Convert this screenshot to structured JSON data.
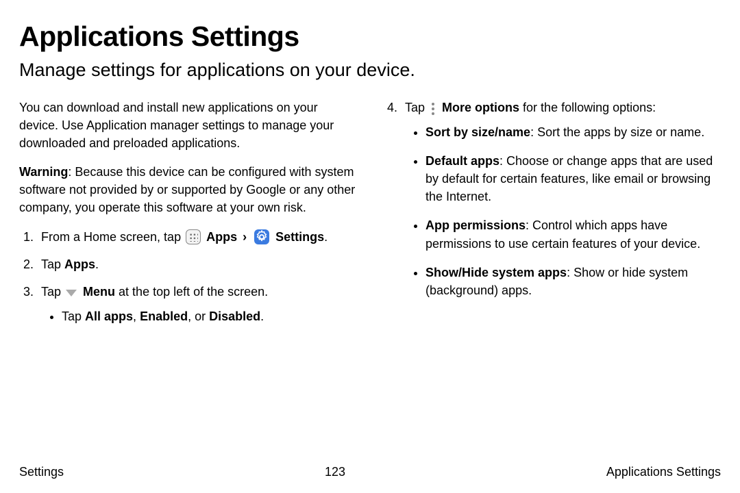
{
  "title": "Applications Settings",
  "subtitle": "Manage settings for applications on your device.",
  "intro": "You can download and install new applications on your device. Use Application manager settings to manage your downloaded and preloaded applications.",
  "warning_label": "Warning",
  "warning_text": ": Because this device can be configured with system software not provided by or supported by Google or any other company, you operate this software at your own risk.",
  "step1_prefix": "From a Home screen, tap ",
  "apps_label": "Apps",
  "chevron": "›",
  "settings_label": "Settings",
  "period": ".",
  "step2_prefix": "Tap ",
  "step2_bold": "Apps",
  "step3_prefix": "Tap ",
  "step3_bold": "Menu",
  "step3_suffix": " at the top left of the screen.",
  "step3_bullet_prefix": "Tap ",
  "step3_b1": "All apps",
  "step3_c1": ", ",
  "step3_b2": "Enabled",
  "step3_c2": ", or ",
  "step3_b3": "Disabled",
  "step4_prefix": "Tap ",
  "step4_bold": "More options",
  "step4_suffix": " for the following options:",
  "opt1_bold": "Sort by size/name",
  "opt1_text": ": Sort the apps by size or name.",
  "opt2_bold": "Default apps",
  "opt2_text": ": Choose or change apps that are used by default for certain features, like email or browsing the Internet.",
  "opt3_bold": "App permissions",
  "opt3_text": ": Control which apps have permissions to use certain features of your device.",
  "opt4_bold": "Show/Hide system apps",
  "opt4_text": ": Show or hide system (background) apps.",
  "footer_left": "Settings",
  "footer_center": "123",
  "footer_right": "Applications Settings"
}
